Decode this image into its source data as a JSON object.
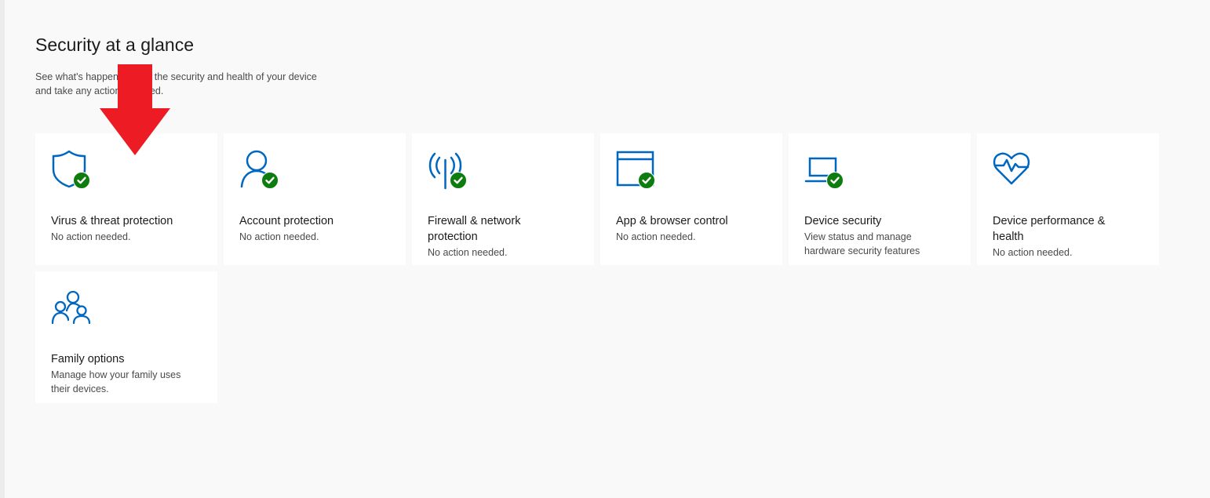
{
  "page": {
    "title": "Security at a glance",
    "description_line1": "See what's happening with the security and health of your device",
    "description_line2": "and take any actions needed."
  },
  "tiles": [
    {
      "id": "virus",
      "icon": "shield-icon",
      "title": "Virus & threat protection",
      "status": "No action needed.",
      "badge": "check-icon"
    },
    {
      "id": "account",
      "icon": "person-icon",
      "title": "Account protection",
      "status": "No action needed.",
      "badge": "check-icon"
    },
    {
      "id": "firewall",
      "icon": "antenna-icon",
      "title": "Firewall & network protection",
      "status": "No action needed.",
      "badge": "check-icon"
    },
    {
      "id": "app",
      "icon": "browser-window-icon",
      "title": "App & browser control",
      "status": "No action needed.",
      "badge": "check-icon"
    },
    {
      "id": "device-security",
      "icon": "laptop-icon",
      "title": "Device security",
      "status": "View status and manage hardware security features",
      "badge": "check-icon"
    },
    {
      "id": "performance",
      "icon": "heart-pulse-icon",
      "title": "Device performance & health",
      "status": "No action needed."
    },
    {
      "id": "family",
      "icon": "family-icon",
      "title": "Family options",
      "status": "Manage how your family uses their devices."
    }
  ],
  "colors": {
    "accent": "#0067c0",
    "ok": "#107c10",
    "annotation_arrow": "#ed1c24"
  }
}
